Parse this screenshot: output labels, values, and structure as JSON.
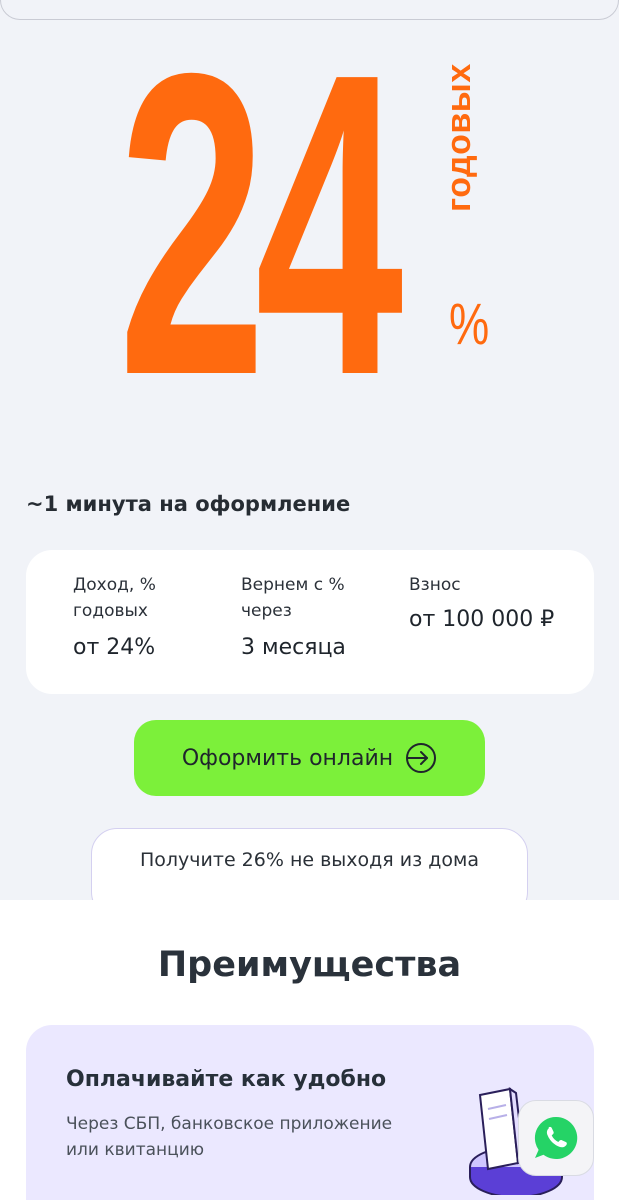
{
  "hero": {
    "rate_number": "24",
    "rate_suffix_vertical": "годовых",
    "percent_sign": "%"
  },
  "subtitle": "~1 минута на оформление",
  "info_card": {
    "columns": [
      {
        "label": "Доход, % годовых",
        "value": "от 24%"
      },
      {
        "label": "Вернем с % через",
        "value": "3 месяца"
      },
      {
        "label": "Взнос",
        "value": "от 100 000 ₽"
      }
    ]
  },
  "cta": {
    "label": "Оформить онлайн",
    "icon": "arrow-right-circle-icon"
  },
  "promo": {
    "text": "Получите 26% не выходя из дома"
  },
  "advantages": {
    "title": "Преимущества",
    "items": [
      {
        "title": "Оплачивайте как удобно",
        "description": "Через СБП, банковское приложение или квитанцию"
      }
    ]
  },
  "whatsapp": {
    "icon": "whatsapp-icon"
  },
  "colors": {
    "accent_orange": "#ff6a0f",
    "cta_green": "#7cf03a",
    "card_lavender": "#ebe8ff",
    "background": "#f1f3f8"
  }
}
